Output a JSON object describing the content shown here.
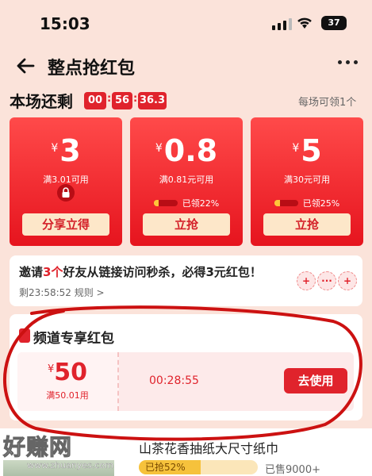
{
  "status_bar": {
    "time": "15:03",
    "battery": "37"
  },
  "header": {
    "title": "整点抢红包"
  },
  "session": {
    "label": "本场还剩",
    "countdown": [
      "00",
      "56",
      "36.3"
    ],
    "note": "每场可领1个"
  },
  "coupons": [
    {
      "yen": "¥",
      "amount": "3",
      "condition": "满3.01可用",
      "locked": true,
      "button": "分享立得"
    },
    {
      "yen": "¥",
      "amount": "0.8",
      "condition": "满0.81元可用",
      "claimed_label": "已领22%",
      "claimed_fraction": 0.22,
      "button": "立抢"
    },
    {
      "yen": "¥",
      "amount": "5",
      "condition": "满30元可用",
      "claimed_label": "已领25%",
      "claimed_fraction": 0.25,
      "button": "立抢"
    }
  ],
  "invite": {
    "prefix": "邀请",
    "count": "3个",
    "suffix": "好友从链接访问秒杀，必得3元红包！",
    "remaining": "剩23:58:52",
    "rules": "规则 >",
    "avatar_symbols": [
      "+",
      "···",
      "+"
    ]
  },
  "channel": {
    "title": "频道专享红包",
    "coupon": {
      "yen": "¥",
      "amount": "50",
      "condition": "满50.01用",
      "timer": "00:28:55",
      "button": "去使用"
    }
  },
  "product": {
    "title": "山茶花香抽纸大尺寸纸巾",
    "grab_label": "已抢52%",
    "grab_fraction": 0.52,
    "sold": "已售9000+"
  },
  "watermark": {
    "text": "好赚网",
    "url": "www.zhuanyes.com"
  },
  "colors": {
    "accent": "#e0232c",
    "background": "#fbe3da",
    "annotation": "#cc1111"
  }
}
